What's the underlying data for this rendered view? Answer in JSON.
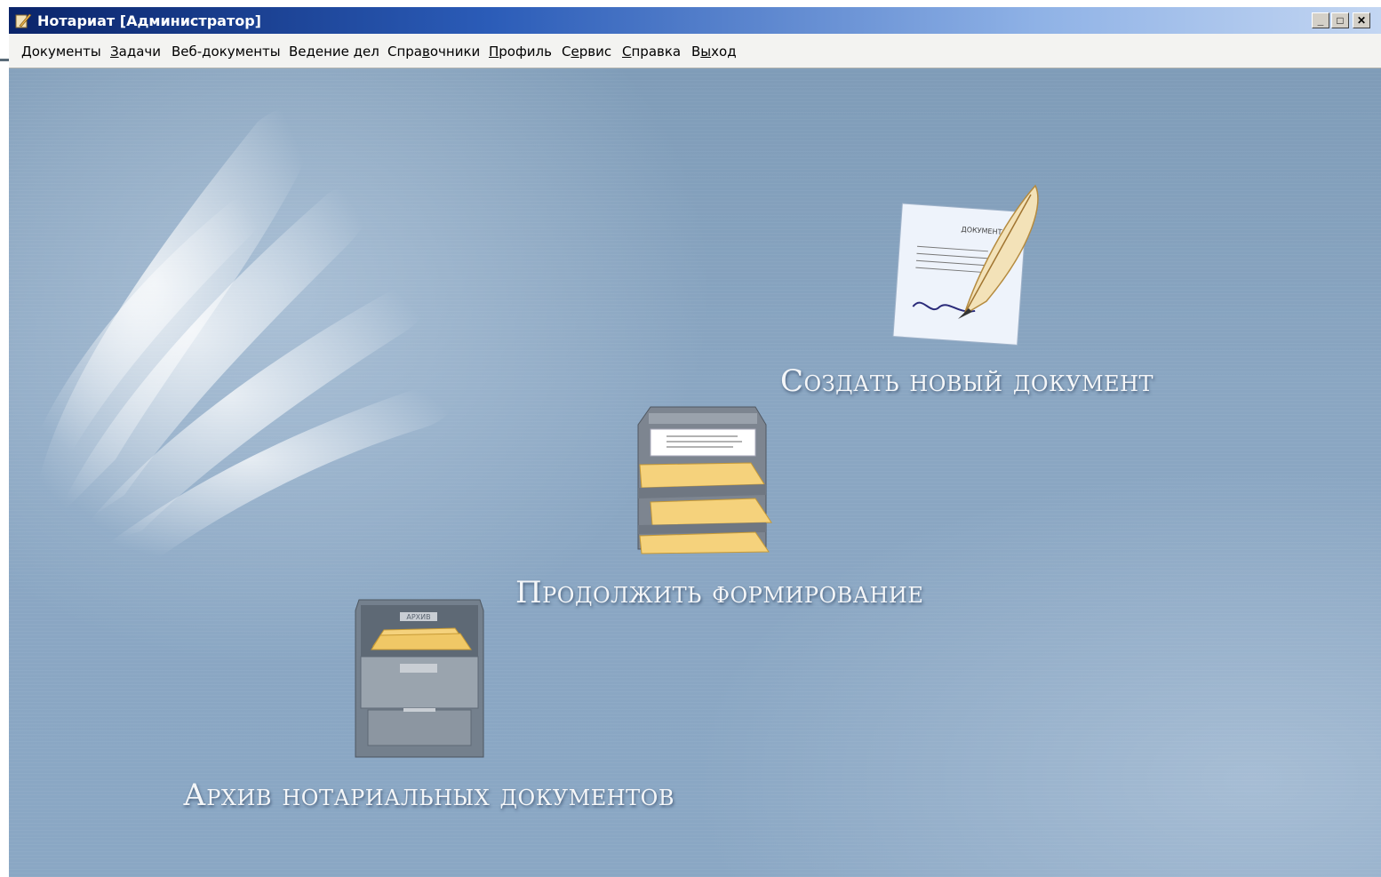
{
  "window": {
    "title": "Нотариат [Администратор]",
    "controls": {
      "minimize": "_",
      "maximize": "□",
      "close": "✕"
    }
  },
  "menu": [
    {
      "pre": "",
      "u": "Д",
      "post": "окументы"
    },
    {
      "pre": "",
      "u": "З",
      "post": "адачи"
    },
    {
      "pre": "Веб-документы",
      "u": "",
      "post": ""
    },
    {
      "pre": "Ведение ",
      "u": "д",
      "post": "ел"
    },
    {
      "pre": "Спра",
      "u": "в",
      "post": "очники"
    },
    {
      "pre": "",
      "u": "П",
      "post": "рофиль"
    },
    {
      "pre": "С",
      "u": "е",
      "post": "рвис"
    },
    {
      "pre": "",
      "u": "С",
      "post": "правка"
    },
    {
      "pre": "В",
      "u": "ы",
      "post": "ход"
    }
  ],
  "actions": {
    "create": {
      "label": "Создать новый документ",
      "icon": "document-quill-icon",
      "doc_title": "ДОКУМЕНТ"
    },
    "continue": {
      "label": "Продолжить формирование",
      "icon": "document-tray-icon"
    },
    "archive": {
      "label": "Архив нотариальных документов",
      "icon": "archive-cabinet-icon",
      "cabinet_label": "АРХИВ"
    }
  },
  "colors": {
    "title_start": "#0a246a",
    "desktop": "#8aa6c2",
    "label": "#f4f6f8"
  }
}
